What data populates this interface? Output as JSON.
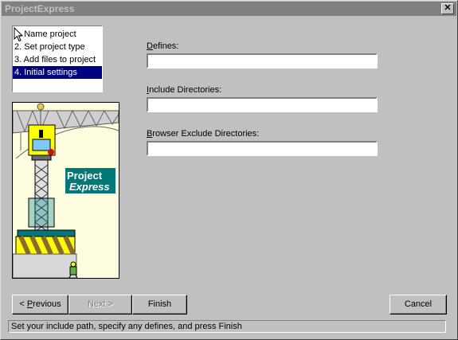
{
  "window": {
    "title": "ProjectExpress",
    "close_glyph": "✕"
  },
  "steps": [
    {
      "label": "1. Name project",
      "selected": false
    },
    {
      "label": "2. Set project type",
      "selected": false
    },
    {
      "label": "3. Add files to project",
      "selected": false
    },
    {
      "label": "4. Initial settings",
      "selected": true
    }
  ],
  "graphic": {
    "line1": "Project",
    "line2": "Express",
    "colors": {
      "teal": "#007878",
      "yellow": "#ffff00",
      "brown": "#8b6b2a",
      "panel": "#fffde0"
    }
  },
  "fields": {
    "defines": {
      "label_ul": "D",
      "label_rest": "efines:",
      "value": ""
    },
    "include": {
      "label_ul": "I",
      "label_rest": "nclude Directories:",
      "value": ""
    },
    "browser": {
      "label_ul": "B",
      "label_rest": "rowser Exclude Directories:",
      "value": ""
    }
  },
  "buttons": {
    "previous": {
      "prefix": "< ",
      "ul": "P",
      "rest": "revious"
    },
    "next": {
      "label": "Next >"
    },
    "finish": {
      "label": "Finish"
    },
    "cancel": {
      "label": "Cancel"
    }
  },
  "status": "Set your include path, specify any defines, and press Finish"
}
